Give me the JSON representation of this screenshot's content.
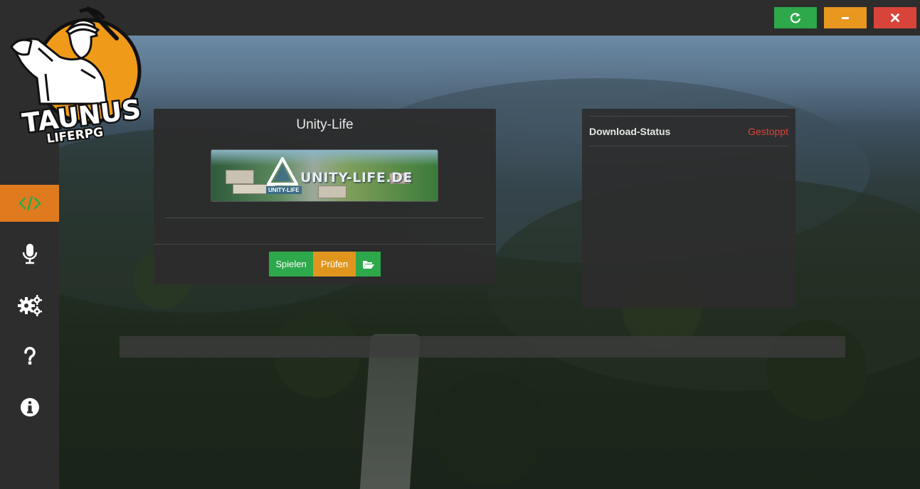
{
  "logo": {
    "title": "TAUNUS",
    "subtitle": "LIFERPG"
  },
  "window_controls": [
    {
      "name": "refresh",
      "icon": "refresh-icon",
      "color": "#2da84a"
    },
    {
      "name": "minimize",
      "icon": "minus-icon",
      "color": "#e8971f"
    },
    {
      "name": "close",
      "icon": "close-icon",
      "color": "#d9443a"
    }
  ],
  "sidebar": {
    "active_color": "#e07a1f",
    "items": [
      {
        "name": "mods",
        "icon": "code-icon",
        "active": true
      },
      {
        "name": "teamspeak",
        "icon": "microphone-icon",
        "active": false
      },
      {
        "name": "settings",
        "icon": "gears-icon",
        "active": false
      },
      {
        "name": "help",
        "icon": "question-icon",
        "active": false
      },
      {
        "name": "info",
        "icon": "info-icon",
        "active": false
      }
    ]
  },
  "server_card": {
    "title": "Unity-Life",
    "banner": {
      "text": "UNITY-LIFE.DE",
      "sub": "UNITY-LIFE"
    },
    "buttons": {
      "play": "Spielen",
      "check": "Prüfen",
      "folder_icon": "folder-open-icon"
    }
  },
  "status_panel": {
    "label": "Download-Status",
    "value": "Gestoppt",
    "value_color": "#d9443a"
  },
  "progress": {
    "fraction": 0
  }
}
